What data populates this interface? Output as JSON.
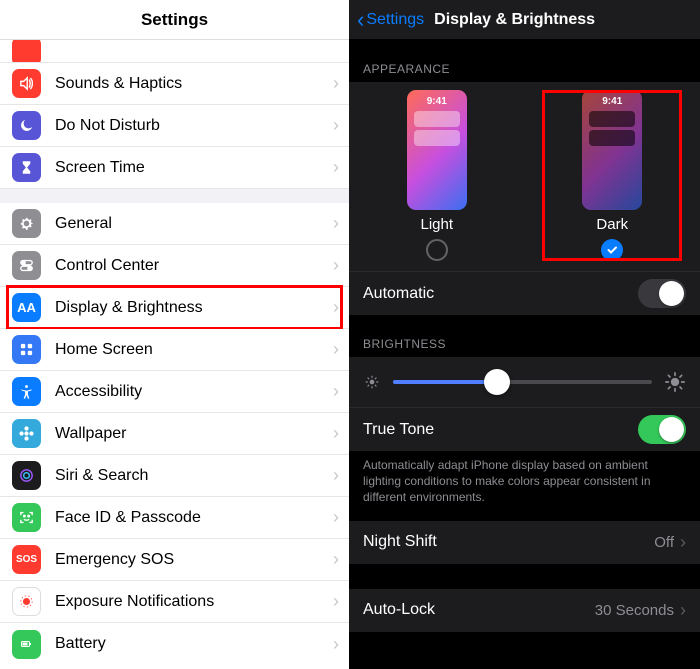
{
  "left": {
    "title": "Settings",
    "rows": [
      {
        "label": "Sounds & Haptics",
        "icon_bg": "#ff3b30"
      },
      {
        "label": "Do Not Disturb",
        "icon_bg": "#5856d6"
      },
      {
        "label": "Screen Time",
        "icon_bg": "#5856d6"
      },
      {
        "label": "General",
        "icon_bg": "#8e8e93"
      },
      {
        "label": "Control Center",
        "icon_bg": "#8e8e93"
      },
      {
        "label": "Display & Brightness",
        "icon_bg": "#0a7cff",
        "highlight": true
      },
      {
        "label": "Home Screen",
        "icon_bg": "#3478f6"
      },
      {
        "label": "Accessibility",
        "icon_bg": "#0a7cff"
      },
      {
        "label": "Wallpaper",
        "icon_bg": "#34aadc"
      },
      {
        "label": "Siri & Search",
        "icon_bg": "#1c1c1e"
      },
      {
        "label": "Face ID & Passcode",
        "icon_bg": "#34c759"
      },
      {
        "label": "Emergency SOS",
        "icon_bg": "#ff3b30"
      },
      {
        "label": "Exposure Notifications",
        "icon_bg": "#ffffff"
      },
      {
        "label": "Battery",
        "icon_bg": "#34c759"
      }
    ]
  },
  "right": {
    "back_label": "Settings",
    "title": "Display & Brightness",
    "appearance": {
      "section": "APPEARANCE",
      "light_label": "Light",
      "dark_label": "Dark",
      "preview_time": "9:41",
      "selected": "dark"
    },
    "automatic": {
      "label": "Automatic",
      "on": false
    },
    "brightness": {
      "section": "BRIGHTNESS",
      "percent": 40
    },
    "truetone": {
      "label": "True Tone",
      "on": true,
      "footer": "Automatically adapt iPhone display based on ambient lighting conditions to make colors appear consistent in different environments."
    },
    "nightshift": {
      "label": "Night Shift",
      "value": "Off"
    },
    "autolock": {
      "label": "Auto-Lock",
      "value": "30 Seconds"
    }
  }
}
